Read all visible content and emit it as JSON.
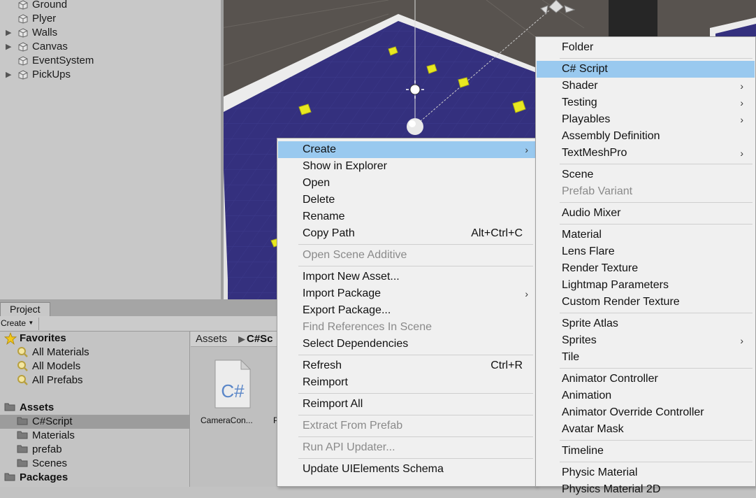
{
  "hierarchy": {
    "items": [
      {
        "label": "Ground",
        "expandable": false
      },
      {
        "label": "Plyer",
        "expandable": false
      },
      {
        "label": "Walls",
        "expandable": true
      },
      {
        "label": "Canvas",
        "expandable": true
      },
      {
        "label": "EventSystem",
        "expandable": false
      },
      {
        "label": "PickUps",
        "expandable": true
      }
    ]
  },
  "project": {
    "tab_label": "Project",
    "create_label": "Create",
    "favorites": {
      "label": "Favorites",
      "items": [
        "All Materials",
        "All Models",
        "All Prefabs"
      ]
    },
    "assets": {
      "label": "Assets",
      "items": [
        "C#Script",
        "Materials",
        "prefab",
        "Scenes"
      ],
      "selected": "C#Script"
    },
    "packages_label": "Packages",
    "breadcrumb": {
      "root": "Assets",
      "current": "C#Sc"
    },
    "files": [
      {
        "label": "CameraCon...",
        "icon": "csharp-file-icon",
        "icon_text": "C#"
      },
      {
        "label": "P"
      }
    ]
  },
  "context_menu": {
    "items": [
      {
        "label": "Create",
        "submenu": true,
        "highlighted": true
      },
      {
        "label": "Show in Explorer"
      },
      {
        "label": "Open"
      },
      {
        "label": "Delete"
      },
      {
        "label": "Rename"
      },
      {
        "label": "Copy Path",
        "shortcut": "Alt+Ctrl+C"
      },
      {
        "separator": true
      },
      {
        "label": "Open Scene Additive",
        "disabled": true
      },
      {
        "separator": true
      },
      {
        "label": "Import New Asset..."
      },
      {
        "label": "Import Package",
        "submenu": true
      },
      {
        "label": "Export Package..."
      },
      {
        "label": "Find References In Scene",
        "disabled": true
      },
      {
        "label": "Select Dependencies"
      },
      {
        "separator": true
      },
      {
        "label": "Refresh",
        "shortcut": "Ctrl+R"
      },
      {
        "label": "Reimport"
      },
      {
        "separator": true
      },
      {
        "label": "Reimport All"
      },
      {
        "separator": true
      },
      {
        "label": "Extract From Prefab",
        "disabled": true
      },
      {
        "separator": true
      },
      {
        "label": "Run API Updater...",
        "disabled": true
      },
      {
        "separator": true
      },
      {
        "label": "Update UIElements Schema"
      }
    ]
  },
  "create_submenu": {
    "items": [
      {
        "label": "Folder"
      },
      {
        "separator": true
      },
      {
        "label": "C# Script",
        "highlighted": true
      },
      {
        "label": "Shader",
        "submenu": true
      },
      {
        "label": "Testing",
        "submenu": true
      },
      {
        "label": "Playables",
        "submenu": true
      },
      {
        "label": "Assembly Definition"
      },
      {
        "label": "TextMeshPro",
        "submenu": true
      },
      {
        "separator": true
      },
      {
        "label": "Scene"
      },
      {
        "label": "Prefab Variant",
        "disabled": true
      },
      {
        "separator": true
      },
      {
        "label": "Audio Mixer"
      },
      {
        "separator": true
      },
      {
        "label": "Material"
      },
      {
        "label": "Lens Flare"
      },
      {
        "label": "Render Texture"
      },
      {
        "label": "Lightmap Parameters"
      },
      {
        "label": "Custom Render Texture"
      },
      {
        "separator": true
      },
      {
        "label": "Sprite Atlas"
      },
      {
        "label": "Sprites",
        "submenu": true
      },
      {
        "label": "Tile"
      },
      {
        "separator": true
      },
      {
        "label": "Animator Controller"
      },
      {
        "label": "Animation"
      },
      {
        "label": "Animator Override Controller"
      },
      {
        "label": "Avatar Mask"
      },
      {
        "separator": true
      },
      {
        "label": "Timeline"
      },
      {
        "separator": true
      },
      {
        "label": "Physic Material"
      },
      {
        "label": "Physics Material 2D"
      }
    ]
  },
  "colors": {
    "menu_bg": "#f0f0f0",
    "menu_highlight": "#99c9ef",
    "disabled_text": "#8a8a8a",
    "scene_floor": "#34307e",
    "pickup": "#e8e820"
  }
}
